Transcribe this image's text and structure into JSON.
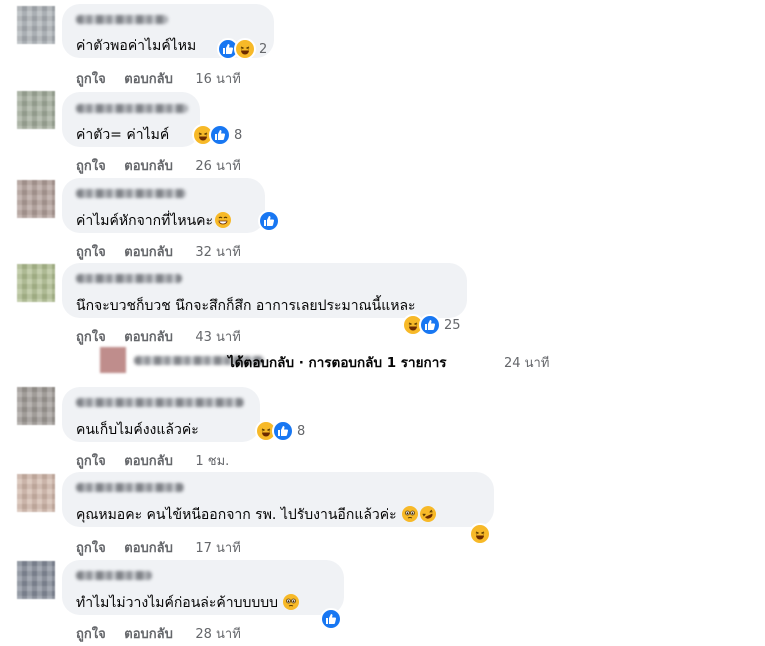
{
  "labels": {
    "like": "ถูกใจ",
    "reply": "ตอบกลับ"
  },
  "colors": {
    "bubble": "#f0f2f5",
    "like_blue": "#1877f2",
    "haha_yellow": "#f7b928",
    "meta_gray": "#65676b"
  },
  "comments": [
    {
      "author": "",
      "text": "ค่าตัวพอค่าไมค์ไหม",
      "reactions": [
        "like",
        "haha"
      ],
      "reaction_count": "2",
      "time": "16 นาที"
    },
    {
      "author": "Nistin Sombatxit",
      "text": "ค่าตัว= ค่าไมค์",
      "reactions": [
        "haha",
        "like"
      ],
      "reaction_count": "8",
      "time": "26 นาที"
    },
    {
      "author": "",
      "text": "ค่าไมค์หักจากที่ไหนคะ",
      "inline_emoji": "grinning-smiling-eyes-emoji",
      "reactions": [
        "like"
      ],
      "reaction_count": "",
      "time": "32 นาที"
    },
    {
      "author": "",
      "text": "นึกจะบวชก็บวช นึกจะสึกก็สึก อาการเลยประมาณนี้แหละ",
      "reactions": [
        "haha",
        "like"
      ],
      "reaction_count": "25",
      "time": "43 นาที"
    },
    {
      "author": "",
      "text": "คนเก็บไมค์งงแล้วค่ะ",
      "reactions": [
        "haha",
        "like"
      ],
      "reaction_count": "8",
      "time": "1 ชม."
    },
    {
      "author": "",
      "text": "คุณหมอคะ คนไข้หนีออกจาก รพ. ไปรับงานอีกแล้วค่ะ",
      "inline_emoji": "pleading-face-emoji rolling-laughing-emoji",
      "reactions": [
        "haha"
      ],
      "reaction_count": "",
      "time": "17 นาที"
    },
    {
      "author": "",
      "text": "ทำไมไม่วางไมค์ก่อนล่ะค้าบบบบบ",
      "inline_emoji": "pleading-face-emoji",
      "reactions": [
        "like"
      ],
      "reaction_count": "",
      "time": "28 นาที"
    }
  ],
  "reply_summary": {
    "text": "ได้ตอบกลับ · การตอบกลับ 1 รายการ",
    "time": "24 นาที"
  }
}
